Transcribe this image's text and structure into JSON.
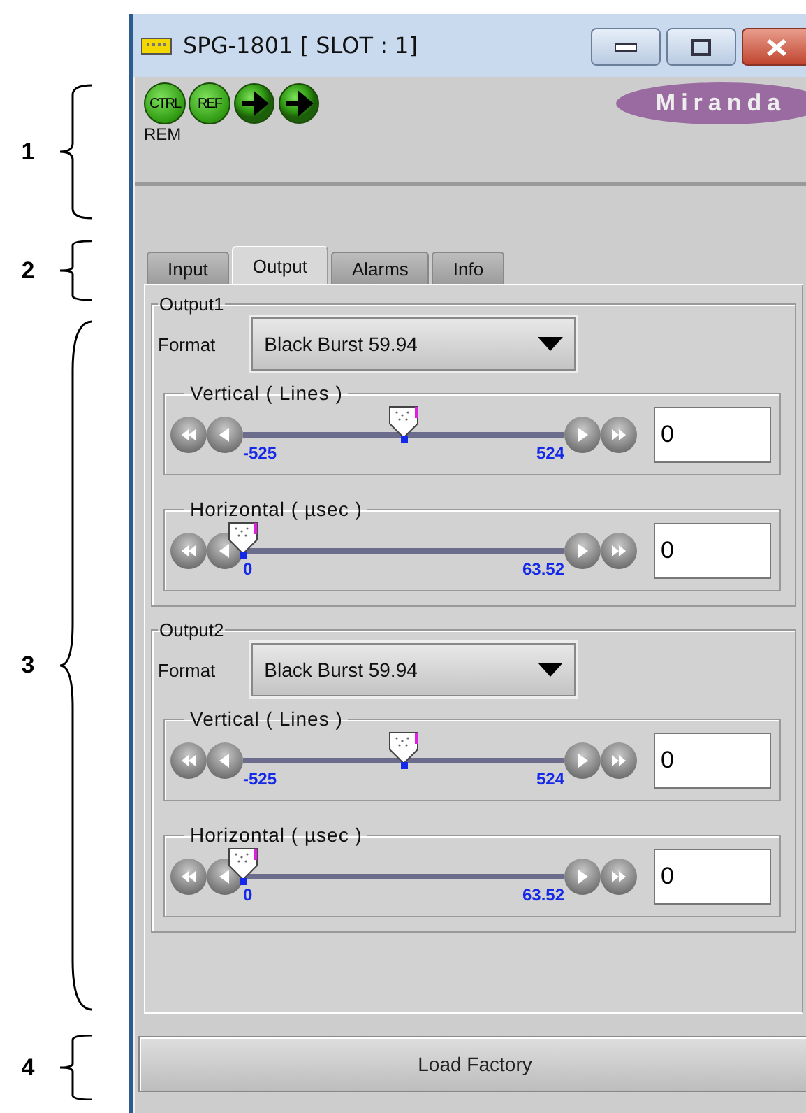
{
  "annotations": [
    "1",
    "2",
    "3",
    "4"
  ],
  "window": {
    "title": "SPG-1801 [ SLOT : 1]"
  },
  "status_icons": [
    {
      "kind": "text",
      "label": "CTRL"
    },
    {
      "kind": "text",
      "label": "REF"
    },
    {
      "kind": "arrow"
    },
    {
      "kind": "arrow"
    }
  ],
  "status_caption": "REM",
  "logo": "Miranda",
  "tabs": [
    {
      "label": "Input",
      "selected": false
    },
    {
      "label": "Output",
      "selected": true
    },
    {
      "label": "Alarms",
      "selected": false
    },
    {
      "label": "Info",
      "selected": false
    }
  ],
  "outputs": [
    {
      "title": "Output1",
      "format_label": "Format",
      "format": "Black Burst 59.94",
      "sliders": [
        {
          "title": "Vertical ( Lines )",
          "min_label": "-525",
          "max_label": "524",
          "level": 0.5,
          "value": "0"
        },
        {
          "title": "Horizontal ( µsec )",
          "min_label": "0",
          "max_label": "63.52",
          "level": 0,
          "value": "0"
        }
      ]
    },
    {
      "title": "Output2",
      "format_label": "Format",
      "format": "Black Burst 59.94",
      "sliders": [
        {
          "title": "Vertical ( Lines )",
          "min_label": "-525",
          "max_label": "524",
          "level": 0.5,
          "value": "0"
        },
        {
          "title": "Horizontal ( µsec )",
          "min_label": "0",
          "max_label": "63.52",
          "level": 0,
          "value": "0"
        }
      ]
    }
  ],
  "button": "Load Factory"
}
